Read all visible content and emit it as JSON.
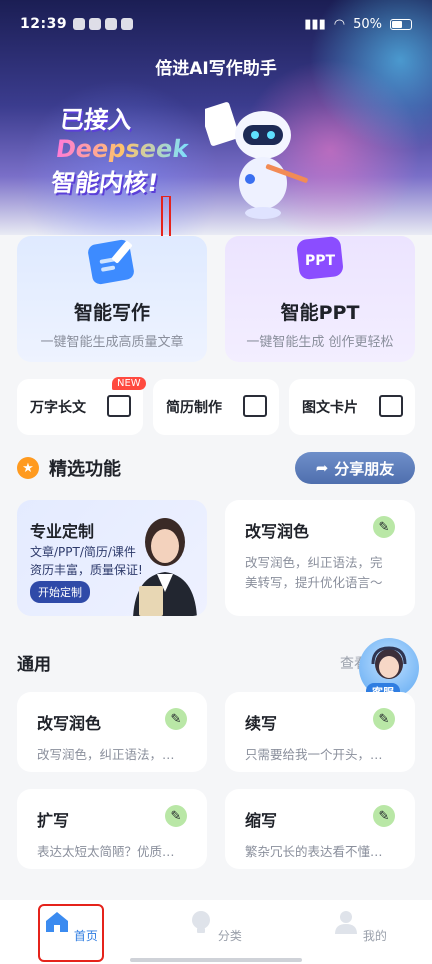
{
  "status_bar": {
    "time": "12:39",
    "battery": "50%"
  },
  "app": {
    "title": "倍进AI写作助手"
  },
  "banner": {
    "line1": "已接入",
    "line2": "Deepseek",
    "line3": "智能内核!"
  },
  "features": [
    {
      "name": "智能写作",
      "desc": "一键智能生成高质量文章"
    },
    {
      "name": "智能PPT",
      "desc": "一键智能生成 创作更轻松",
      "icon_text": "PPT"
    }
  ],
  "tools": [
    {
      "label": "万字长文",
      "badge": "NEW"
    },
    {
      "label": "简历制作"
    },
    {
      "label": "图文卡片"
    }
  ],
  "featured": {
    "title": "精选功能",
    "share_label": "分享朋友"
  },
  "promo": {
    "title": "专业定制",
    "line1": "文章/PPT/简历/课件",
    "line2": "资历丰富，质量保证!",
    "button": "开始定制"
  },
  "featured_card": {
    "title": "改写润色",
    "desc1": "改写润色，纠正语法，完",
    "desc2": "美转写，提升优化语言～"
  },
  "general": {
    "title": "通用",
    "more": "查看"
  },
  "service": {
    "label": "客服"
  },
  "general_items": [
    {
      "title": "改写润色",
      "desc": "改写润色，纠正语法，…"
    },
    {
      "title": "续写",
      "desc": "只需要给我一个开头，…"
    },
    {
      "title": "扩写",
      "desc": "表达太短太简陋？优质…"
    },
    {
      "title": "缩写",
      "desc": "繁杂冗长的表达看不懂…"
    }
  ],
  "tabs": [
    {
      "label": "首页",
      "active": true
    },
    {
      "label": "分类"
    },
    {
      "label": "我的"
    }
  ],
  "colors": {
    "accent": "#2f7de1",
    "highlight_frame": "#e5231b",
    "arrow": "#e5231b"
  }
}
